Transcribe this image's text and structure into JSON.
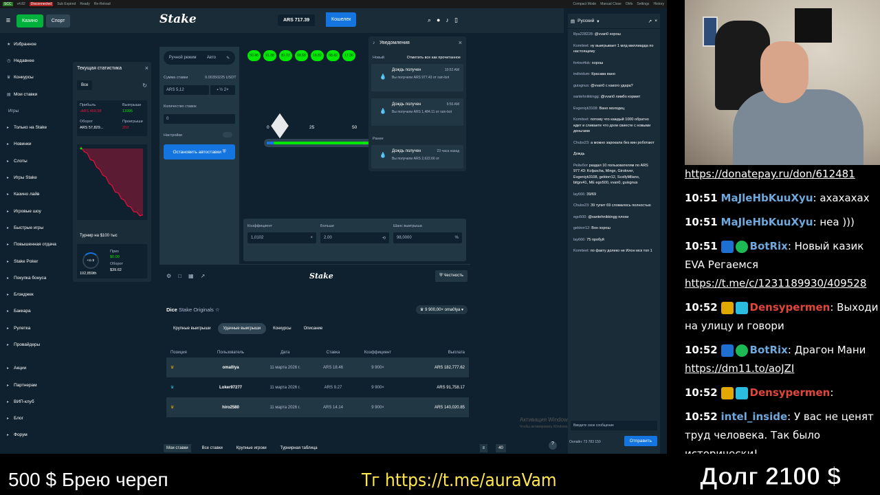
{
  "topstrip": {
    "tag": "SCC",
    "ver": "v4.82",
    "status": "Disconnected",
    "misc": "Sub Expired",
    "ready": "Ready",
    "reload": "Re-Reload",
    "compact": "Compact Mode",
    "manual": "Manual Close",
    "obfs": "Obfs",
    "settings": "Settings",
    "history": "History"
  },
  "header": {
    "casino": "Казино",
    "sport": "Спорт",
    "logo": "Stake",
    "balance": "ARS 717.39",
    "wallet": "Кошелек"
  },
  "sidebar": {
    "items": [
      {
        "label": "Избранное"
      },
      {
        "label": "Недавнее"
      },
      {
        "label": "Конкурсы"
      },
      {
        "label": "Мои ставки"
      }
    ],
    "games_head": "Игры",
    "games": [
      {
        "label": "Только на Stake"
      },
      {
        "label": "Новинки"
      },
      {
        "label": "Слоты"
      },
      {
        "label": "Игры Stake"
      },
      {
        "label": "Казино лайв"
      },
      {
        "label": "Игровые шоу"
      },
      {
        "label": "Быстрые игры"
      },
      {
        "label": "Повышенная отдача"
      },
      {
        "label": "Stake Poker"
      },
      {
        "label": "Покупка бонуса"
      },
      {
        "label": "Блэкджек"
      },
      {
        "label": "Баккара"
      },
      {
        "label": "Рулетка"
      },
      {
        "label": "Провайдеры"
      }
    ],
    "bottom": [
      {
        "label": "Акции"
      },
      {
        "label": "Партнерам"
      },
      {
        "label": "ВИП-клуб"
      },
      {
        "label": "Блог"
      },
      {
        "label": "Форум"
      }
    ]
  },
  "stats": {
    "title": "Текущая статистика",
    "filter": "Все",
    "profit_label": "Прибыль",
    "profit": "-ARS 459,58",
    "wins_label": "Выигрыши",
    "wins": "11095",
    "wager_label": "Оборот",
    "wager": "ARS 57,829...",
    "losses_label": "Проигрыши",
    "losses": "203",
    "tournament": "Турнир на $100 тыс",
    "t_value": "+11 $",
    "t_prize_label": "Приз",
    "t_prize": "$0.00",
    "t_rank": "102,859th",
    "t_turnover_label": "Оборот",
    "t_turnover": "$39.62"
  },
  "chart_data": {
    "type": "line",
    "x": [
      0,
      1,
      2,
      3,
      4,
      5,
      6,
      7,
      8,
      9,
      10,
      11,
      12,
      13,
      14,
      15,
      16,
      17,
      18,
      19,
      20
    ],
    "values": [
      0,
      -15,
      -40,
      -70,
      -90,
      -120,
      -150,
      -175,
      -200,
      -230,
      -260,
      -290,
      -310,
      -335,
      -360,
      -385,
      -405,
      -425,
      -440,
      -452,
      -459.58
    ],
    "title": "",
    "xlabel": "",
    "ylabel": "",
    "color": "#e9113c",
    "grid": false
  },
  "control": {
    "manual": "Ручной режим",
    "auto": "Авто",
    "bet_label": "Сумма ставки",
    "bet_usd": "0.00350225 USDT",
    "bet_value": "ARS 5,12",
    "count_label": "Количество ставок",
    "count_value": "0",
    "settings_label": "Настройки",
    "autostop": "Остановить автоставки"
  },
  "pills": [
    "50.46",
    "91.38",
    "81.02",
    "68.68",
    "16.82",
    "68.42",
    "17.36"
  ],
  "slider": {
    "t0": "0",
    "t25": "25",
    "t50": "50",
    "progress": 0.58
  },
  "bottombar": {
    "mult_label": "Коэффициент",
    "mult": "1,0102",
    "more_label": "Больше",
    "more": "2.00",
    "chance_label": "Шанс выигрыша",
    "chance": "98,0000"
  },
  "gamefooter": {
    "logo": "Stake",
    "fair": "Честность"
  },
  "notif": {
    "title": "Уведомления",
    "new": "Новый",
    "mark_all": "Отметить все как прочитанное",
    "earlier": "Ранее",
    "items": [
      {
        "title": "Дождь получен",
        "time": "10:52 AM",
        "body": "Вы получили ARS 977.43 от rain-bot"
      },
      {
        "title": "Дождь получен",
        "time": "9:56 AM",
        "body": "Вы получили ARS 1,484.11 от rain-bot"
      },
      {
        "title": "Дождь получен",
        "time": "23 часа назад",
        "body": "Вы получили ARS 2,622.66 от"
      }
    ]
  },
  "dice": {
    "title": "Dice",
    "subtitle": "Stake Originals",
    "badge": "9 900,00× oma0lya",
    "tabs": [
      "Крупные выигрыши",
      "Удачные выигрыши",
      "Конкурсы",
      "Описание"
    ],
    "columns": [
      "Позиция",
      "Пользователь",
      "Дата",
      "Ставка",
      "Коэффициент",
      "Выплата"
    ],
    "rows": [
      {
        "user": "oma0lya",
        "date": "11 марта 2026 г.",
        "bet": "ARS 18.46",
        "mult": "9 900×",
        "pay": "ARS 182,777.62"
      },
      {
        "user": "Loker97277",
        "date": "11 марта 2026 г.",
        "bet": "ARS 9.27",
        "mult": "9 900×",
        "pay": "ARS 91,758.17"
      },
      {
        "user": "hiro2580",
        "date": "11 марта 2026 г.",
        "bet": "ARS 14.14",
        "mult": "9 900×",
        "pay": "ARS 140,020.85"
      }
    ]
  },
  "btabs": [
    "Мои ставки",
    "Все ставки",
    "Крупные игроки",
    "Турнирная таблица"
  ],
  "btabs_count": "40",
  "activation": {
    "title": "Активация Windows",
    "sub": "Чтобы активировать Windows, перейдите в раздел \"Параметры\"."
  },
  "chatpanel": {
    "lang": "Русский",
    "msgs": [
      {
        "u": "lllya228228:",
        "t": "@vvan0 хорош"
      },
      {
        "u": "Komiteet:",
        "t": "ну выигрывает 1 млд миллиарда по настоящему"
      },
      {
        "u": "fortovi4ok:",
        "t": "хорош"
      },
      {
        "u": "individum:",
        "t": "Красава вано"
      },
      {
        "u": "guisgnus:",
        "t": "@vvan0 с какого удара?"
      },
      {
        "u": "santehnikkingg:",
        "t": "@vvan0 лимбо кормит"
      },
      {
        "u": "Evgeniyk3108:",
        "t": "Вано молодец"
      },
      {
        "u": "Komiteet:",
        "t": "потому что каждый 1000 обратно идет и сливаете что доли свиесте с новыми деньгами"
      },
      {
        "u": "Chubs23:",
        "t": "а можно зарокала без вин роботают"
      },
      {
        "u": "",
        "t": "Дождь"
      },
      {
        "u": "Рейнбот",
        "t": "раздал 10 пользователям по ARS 977.43: Koljascha, Mingx, Girolover, Evgeniyk3108, gektorr12, ScollyMilano, bitgrv41, ME ego500, vvan0, guisgnus"
      },
      {
        "u": "lay666:",
        "t": "39/69"
      },
      {
        "u": "Chubs23:",
        "t": "39 тупит 69 сломалось полностью"
      },
      {
        "u": "ego500:",
        "t": "@santehnikkingg плохи"
      },
      {
        "u": "gektorr12:",
        "t": "Вон хорош"
      },
      {
        "u": "lay666:",
        "t": "75 пробуй"
      },
      {
        "u": "Komiteet:",
        "t": "по факту долеко не Илон мск топ 1"
      }
    ],
    "input": "Введите свое сообщение",
    "online": "Онлайн: 73 783",
    "count": "150",
    "send": "Отправить"
  },
  "stream_chat": [
    {
      "time": "",
      "nick": "",
      "text": "",
      "link": "https://donatepay.ru/don/612481"
    },
    {
      "time": "10:51",
      "nick": "MaJleHbKuuXyu",
      "text": ": ахахахах",
      "link": ""
    },
    {
      "time": "10:51",
      "nick": "MaJleHbKuuXyu",
      "text": ": неа )))",
      "link": ""
    },
    {
      "time": "10:51",
      "nick": "BotRix",
      "text": ": Новый казик EVA Регаемся",
      "link": "https://t.me/c/1231189930/409528"
    },
    {
      "time": "10:52",
      "nick": "Densypermen",
      "text": ": Выходи на улицу и говори",
      "link": ""
    },
    {
      "time": "10:52",
      "nick": "BotRix",
      "text": ": Драгон Мани",
      "link": "https://dm11.to/aoJZI"
    },
    {
      "time": "10:52",
      "nick": "Densypermen",
      "text": ":",
      "link": ""
    },
    {
      "time": "10:52",
      "nick": "intel_inside",
      "text": ": У вас не ценят труд человека. Так было исторически!",
      "link": ""
    }
  ],
  "overlay": {
    "left": "500 $ Брею череп",
    "mid": "Tг https://t.me/auraVam",
    "right": "Долг 2100 $"
  },
  "colors": {
    "bg": "#0f212e",
    "panel": "#1a2c38",
    "accent_green": "#00e701",
    "accent_blue": "#1475e1",
    "loss_red": "#e9113c"
  }
}
